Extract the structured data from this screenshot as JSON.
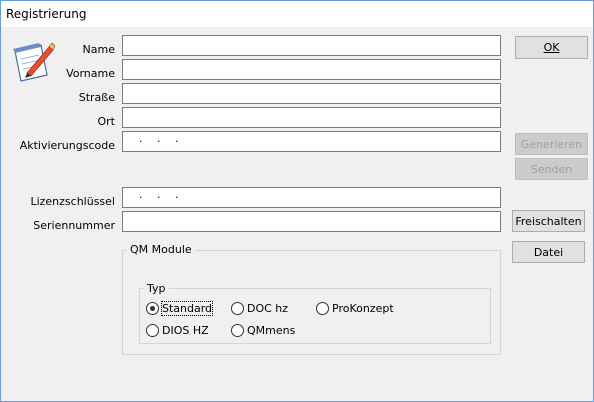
{
  "window": {
    "title": "Registrierung"
  },
  "icon": "registration-pen-paper-icon",
  "form": {
    "name_label": "Name",
    "name_value": "",
    "vorname_label": "Vorname",
    "vorname_value": "",
    "strasse_label": "Straße",
    "strasse_value": "",
    "ort_label": "Ort",
    "ort_value": "",
    "aktivierungscode_label": "Aktivierungscode",
    "aktivierungscode_value": "·   ·   ·",
    "lizenzschluessel_label": "Lizenzschlüssel",
    "lizenzschluessel_value": "·   ·   ·",
    "seriennummer_label": "Seriennummer",
    "seriennummer_value": ""
  },
  "buttons": {
    "ok": "OK",
    "generieren": "Generieren",
    "senden": "Senden",
    "freischalten": "Freischalten",
    "datei": "Datei"
  },
  "qm_module": {
    "title": "QM Module",
    "typ_title": "Typ",
    "options": [
      "Standard",
      "DOC hz",
      "ProKonzept",
      "DIOS HZ",
      "QMmens"
    ],
    "selected": "Standard"
  }
}
